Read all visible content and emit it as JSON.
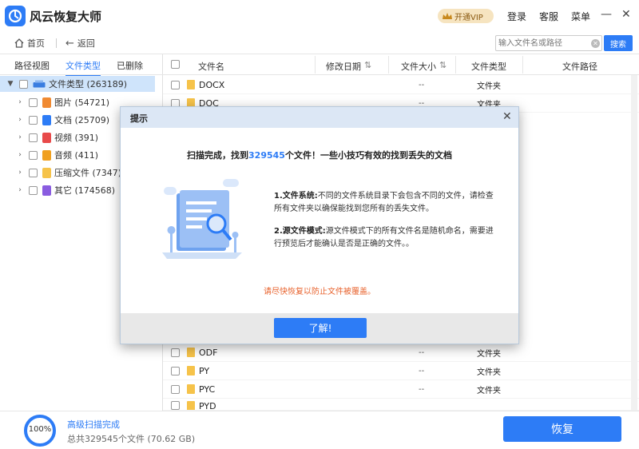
{
  "app": {
    "title": "风云恢复大师"
  },
  "titlebar": {
    "vip_label": "开通VIP",
    "login": "登录",
    "service": "客服",
    "menu": "菜单",
    "minimize": "—",
    "close": "✕"
  },
  "toolbar": {
    "home": "首页",
    "back": "返回",
    "search_placeholder": "输入文件名或路径",
    "search_btn": "搜索"
  },
  "leftpanel": {
    "tabs": [
      "路径视图",
      "文件类型",
      "已删除"
    ],
    "active_tab": 1,
    "root": {
      "label": "文件类型 (263189)"
    },
    "items": [
      {
        "label": "图片 (54721)",
        "icon": "image-icon",
        "color": "#f08a32"
      },
      {
        "label": "文档 (25709)",
        "icon": "document-icon",
        "color": "#2d7cf6"
      },
      {
        "label": "视频 (391)",
        "icon": "video-icon",
        "color": "#e84a4a"
      },
      {
        "label": "音频 (411)",
        "icon": "audio-icon",
        "color": "#f0a020"
      },
      {
        "label": "压缩文件 (7347)",
        "icon": "archive-icon",
        "color": "#f6c34a"
      },
      {
        "label": "其它 (174568)",
        "icon": "other-icon",
        "color": "#8a5ce0"
      }
    ]
  },
  "table": {
    "headers": {
      "name": "文件名",
      "date": "修改日期",
      "size": "文件大小",
      "type": "文件类型",
      "path": "文件路径"
    },
    "rows": [
      {
        "name": "DOCX",
        "size": "--",
        "type": "文件夹"
      },
      {
        "name": "DOC",
        "size": "--",
        "type": "文件夹"
      },
      {
        "name": "ODF",
        "size": "--",
        "type": "文件夹"
      },
      {
        "name": "PY",
        "size": "--",
        "type": "文件夹"
      },
      {
        "name": "PYC",
        "size": "--",
        "type": "文件夹"
      },
      {
        "name": "PYD",
        "size": "--",
        "type": "文件夹"
      }
    ]
  },
  "bottom": {
    "progress": "100%",
    "progress_fraction": 1.0,
    "status": "高级扫描完成",
    "summary": "总共329545个文件 (70.62 GB)",
    "recover_btn": "恢复"
  },
  "dialog": {
    "title": "提示",
    "close": "✕",
    "headline_pre": "扫描完成，找到",
    "headline_num": "329545",
    "headline_post": "个文件！一些小技巧有效的找到丢失的文档",
    "tip1_title": "1.文件系统:",
    "tip1_text": "不同的文件系统目录下会包含不同的文件，请检查所有文件夹以确保能找到您所有的丢失文件。",
    "tip2_title": "2.源文件模式:",
    "tip2_text": "源文件模式下的所有文件名是随机命名，需要进行预览后才能确认是否是正确的文件。。",
    "warning": "请尽快恢复以防止文件被覆盖。",
    "ok_btn": "了解!"
  },
  "colors": {
    "accent": "#2d7cf6",
    "warning": "#e8632e",
    "folder": "#f6c34a",
    "selected_row": "#cfe4fb"
  }
}
